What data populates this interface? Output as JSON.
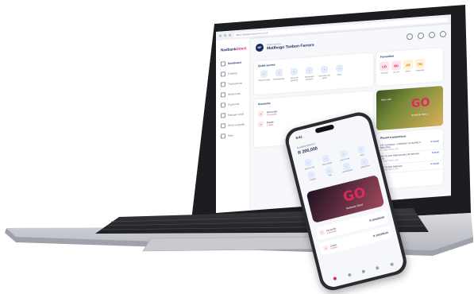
{
  "browser": {
    "url": "https://apidgdevweb.mn.co.za/"
  },
  "app": {
    "brand_main": "Nedbank",
    "brand_accent": "Direct"
  },
  "sidebar": {
    "items": [
      {
        "label": "Dashboard",
        "active": true
      },
      {
        "label": "Funding",
        "active": false
      },
      {
        "label": "Transactions",
        "active": false
      },
      {
        "label": "Statements",
        "active": false
      },
      {
        "label": "Payments",
        "active": false
      },
      {
        "label": "Manage cards",
        "active": false
      },
      {
        "label": "Send a payslip",
        "active": false
      },
      {
        "label": "More",
        "active": false
      }
    ]
  },
  "header": {
    "initials": "MF",
    "greeting": "Good morning",
    "name": "Matlhogo Tsebon Ferrers"
  },
  "quick_access": {
    "title": "Quick access",
    "items": [
      {
        "label": "Transfer funds",
        "icon": "transfer-icon"
      },
      {
        "label": "Beneficiaries",
        "icon": "people-icon"
      },
      {
        "label": "Once-off payment",
        "icon": "pay-icon"
      },
      {
        "label": "Scheduled payment",
        "icon": "calendar-icon"
      },
      {
        "label": "Accounts and cards",
        "icon": "card-icon"
      },
      {
        "label": "More",
        "icon": "more-icon"
      }
    ]
  },
  "favourites": {
    "title": "Favourites",
    "items": [
      {
        "initials": "CB",
        "label": "Chemists",
        "color": "#fde5ec",
        "text_color": "#e0295f"
      },
      {
        "initials": "ND",
        "label": "my card",
        "color": "#fde5ec",
        "text_color": "#e0295f"
      },
      {
        "initials": "AB",
        "label": "Airtime",
        "color": "#fef3d6",
        "text_color": "#c98a10"
      },
      {
        "initials": "DN",
        "label": "Classifieds",
        "color": "#fef3d6",
        "text_color": "#c98a10"
      }
    ]
  },
  "accounts": {
    "title": "Accounts",
    "items": [
      {
        "name": "Accounts",
        "sub": "3 Accounts",
        "icon": "wallet-icon"
      },
      {
        "name": "Cards",
        "sub": "2 cards",
        "icon": "card-icon"
      }
    ]
  },
  "promo": {
    "go_text": "GO",
    "go_suffix": "Direct",
    "line1": "More with",
    "line2": "Nedbank Direct"
  },
  "recent": {
    "title": "Recent transactions",
    "items": [
      {
        "desc": "PIS Transaction - STARRENT OF BARRETT 6810 (NW)",
        "date": "17 Sept 2025 12:00",
        "amount": "R 120.00"
      },
      {
        "desc": "PAY TO SOS RABOSHI BN CAD INSTANT 5.95",
        "date": "17 Sept 2025 12:00",
        "amount": "R 25.00"
      },
      {
        "desc": "PAY TO SOS RABOSHI",
        "date": "17 Sept 2025 12:00",
        "amount": "R 100.00"
      }
    ]
  },
  "phone": {
    "time": "9:41",
    "balance_label": "Available balance",
    "balance_value": "R 200,000",
    "grid": [
      {
        "label": "Send money",
        "icon": "send-icon"
      },
      {
        "label": "Buy prepaid",
        "icon": "prepaid-icon"
      },
      {
        "label": "Scan to pay",
        "icon": "scan-icon"
      },
      {
        "label": "More",
        "icon": "more-icon"
      },
      {
        "label": "Transfer",
        "icon": "transfer-icon"
      },
      {
        "label": "Pay",
        "icon": "pay-icon"
      },
      {
        "label": "Beneficiaries",
        "icon": "people-icon"
      },
      {
        "label": "Statements",
        "icon": "doc-icon"
      }
    ],
    "accounts": [
      {
        "name": "Accounts",
        "sub": "3 Accounts",
        "value": "R 100,000.00"
      },
      {
        "name": "Cards",
        "sub": "2 cards",
        "value": "R 100,000.00"
      }
    ]
  }
}
